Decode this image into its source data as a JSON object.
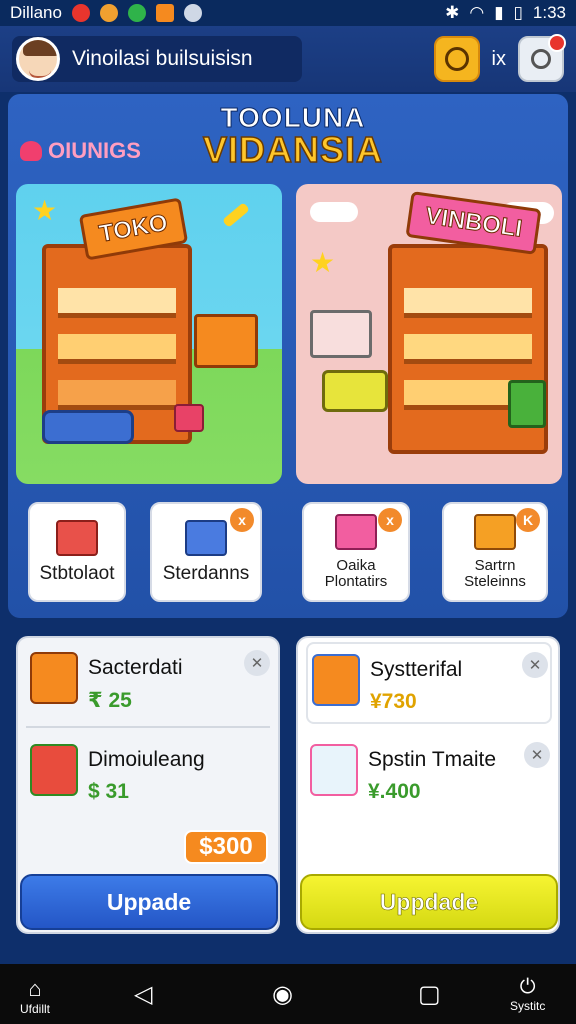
{
  "status_bar": {
    "carrier": "Dillano",
    "time": "1:33"
  },
  "header": {
    "profile_name": "Vinoilasi builsuisisn",
    "x_label": "ix"
  },
  "banner": {
    "title_line1": "TOOLUNA",
    "title_line2": "VIDANSIA",
    "side_label": "OIUNIGS",
    "left_store_sign": "TOKO",
    "right_store_sign": "VINBOLI"
  },
  "tiles": [
    {
      "label": "Stbtolaot",
      "close": ""
    },
    {
      "label": "Sterdanns",
      "close": "x"
    },
    {
      "label": "Oaika Plontatirs",
      "close": "x"
    },
    {
      "label": "Sartrn Steleinns",
      "close": "K"
    }
  ],
  "upgrade_left": {
    "items": [
      {
        "name": "Sacterdati",
        "price": "₹ 25"
      },
      {
        "name": "Dimoiuleang",
        "price": "$ 31"
      }
    ],
    "total": "$300",
    "button": "Uppade"
  },
  "upgrade_right": {
    "items": [
      {
        "name": "Systterifal",
        "price": "¥730"
      },
      {
        "name": "Spstin Tmaite",
        "price": "¥.400"
      }
    ],
    "button": "Uppdade"
  },
  "bottom_nav": {
    "home_label": "Ufdillt",
    "right_label": "Systitc"
  },
  "colors": {
    "accent_blue": "#2456c6",
    "accent_yellow": "#f6f431",
    "price_green": "#3a9b2c",
    "price_orange": "#f58a1f"
  }
}
